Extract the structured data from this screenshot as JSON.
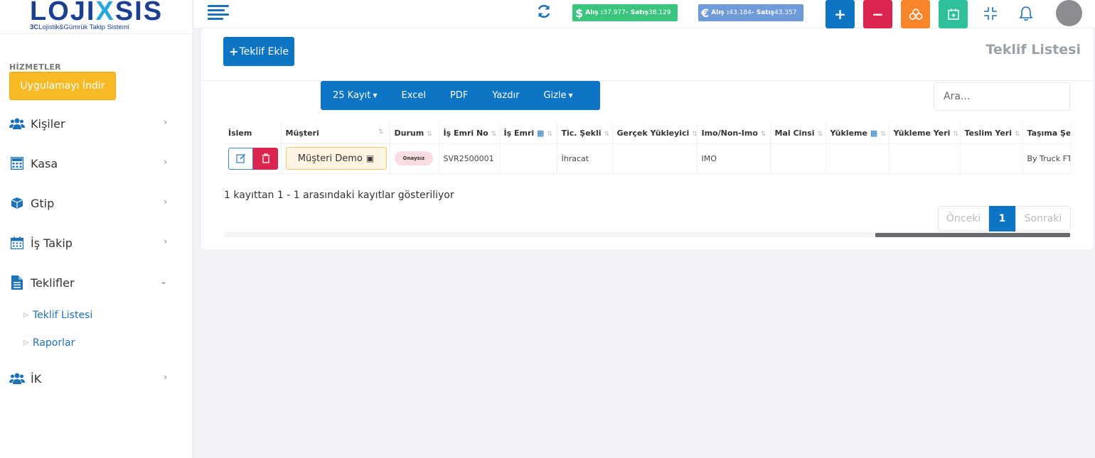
{
  "logo": {
    "brand_main": "LOJI",
    "brand_x": "X",
    "brand_end": "SIS",
    "subtitle_bold": "3C",
    "subtitle": "Lojistik&Gümrük Takip Sistemi"
  },
  "sidebar": {
    "section_label": "HİZMETLER",
    "app_button": "Uygulamayı İndir",
    "items": [
      {
        "label": "Kişiler",
        "icon": "users-icon"
      },
      {
        "label": "Kasa",
        "icon": "calculator-icon"
      },
      {
        "label": "Gtip",
        "icon": "cube-icon"
      },
      {
        "label": "İş Takip",
        "icon": "calendar-icon"
      },
      {
        "label": "Teklifler",
        "icon": "file-icon"
      },
      {
        "label": "İK",
        "icon": "users-icon"
      }
    ],
    "subitems": [
      "Teklif Listesi",
      "Raporlar"
    ]
  },
  "topbar": {
    "usd_symbol": "$",
    "usd_prefix": "Alış : ",
    "usd_buy": "37.977",
    "usd_mid": " - Satış ",
    "usd_sell": "38.129",
    "eur_symbol": "€",
    "eur_prefix": "Alış : ",
    "eur_buy": "43.184",
    "eur_mid": " - Satış ",
    "eur_sell": "43.357",
    "colors": {
      "blue": "#0e74c4",
      "red": "#d92550",
      "orange": "#f7852b",
      "teal": "#2fbf9b",
      "usd": "#3ac47d",
      "eur": "#6f9bd8"
    }
  },
  "main": {
    "add_button": "Teklif Ekle",
    "page_title": "Teklif Listesi",
    "toolbar": {
      "records": "25 Kayıt",
      "excel": "Excel",
      "pdf": "PDF",
      "print": "Yazdır",
      "hide": "Gizle"
    },
    "search_placeholder": "Ara...",
    "table": {
      "headers": [
        "İslem",
        "Müşteri",
        "Durum",
        "İş Emri No",
        "İş Emri",
        "Tic. Şekli",
        "Gerçek Yükleyici",
        "Imo/Non-Imo",
        "Mal Cinsi",
        "Yükleme",
        "Yükleme Yeri",
        "Teslim Yeri",
        "Taşıma Şek"
      ],
      "rows": [
        {
          "customer": "Müşteri Demo",
          "status": "Onaysız",
          "order_no": "SVR2500001",
          "order_date": "",
          "trade_type": "İhracat",
          "real_loader": "",
          "imo": "IMO",
          "goods": "",
          "loading": "",
          "loading_place": "",
          "delivery_place": "",
          "transport": "By Truck FT"
        }
      ]
    },
    "info": "1 kayıttan 1 - 1 arasındaki kayıtlar gösteriliyor",
    "pager": {
      "prev": "Önceki",
      "current": "1",
      "next": "Sonraki"
    }
  }
}
